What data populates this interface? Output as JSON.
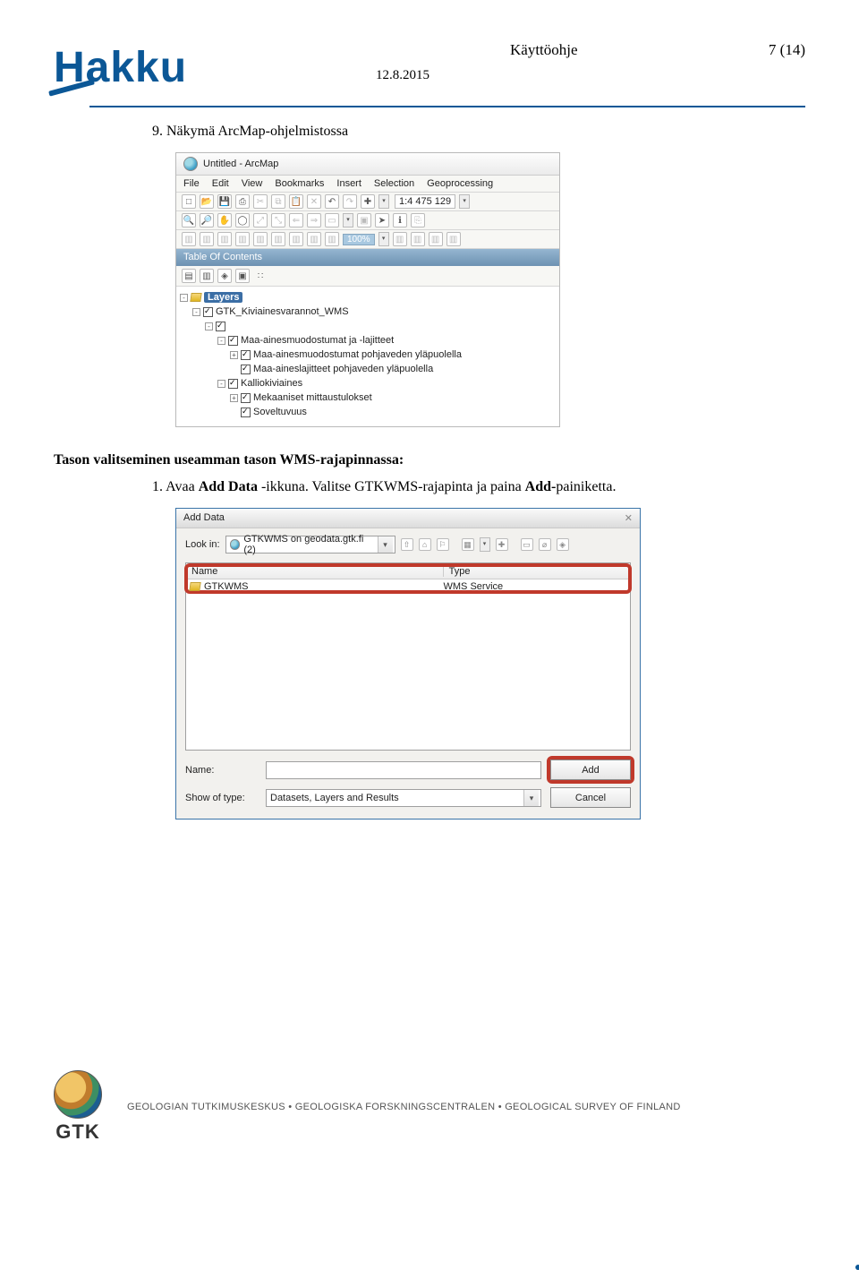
{
  "header": {
    "logo_text": "Hakku",
    "doc_title": "Käyttöohje",
    "page_of": "7 (14)",
    "date": "12.8.2015"
  },
  "step9": {
    "num": "9.",
    "text": "Näkymä ArcMap-ohjelmistossa"
  },
  "arcmap": {
    "title": "Untitled - ArcMap",
    "menu": [
      "File",
      "Edit",
      "View",
      "Bookmarks",
      "Insert",
      "Selection",
      "Geoprocessing"
    ],
    "scale": "1:4 475 129",
    "percent": "100%",
    "toc_title": "Table Of Contents",
    "layers_label": "Layers",
    "tree": [
      {
        "label": "GTK_Kiviainesvarannot_WMS",
        "indent": 1,
        "checked": true,
        "expander": "-"
      },
      {
        "label": "",
        "indent": 2,
        "checked": true,
        "expander": "-"
      },
      {
        "label": "Maa-ainesmuodostumat ja -lajitteet",
        "indent": 3,
        "checked": true,
        "expander": "-"
      },
      {
        "label": "Maa-ainesmuodostumat pohjaveden yläpuolella",
        "indent": 4,
        "checked": true,
        "expander": "+"
      },
      {
        "label": "Maa-aineslajitteet pohjaveden yläpuolella",
        "indent": 4,
        "checked": true,
        "expander": ""
      },
      {
        "label": "Kalliokiviaines",
        "indent": 3,
        "checked": true,
        "expander": "-"
      },
      {
        "label": "Mekaaniset mittaustulokset",
        "indent": 4,
        "checked": true,
        "expander": "+"
      },
      {
        "label": "Soveltuvuus",
        "indent": 4,
        "checked": true,
        "expander": ""
      }
    ]
  },
  "section_heading": "Tason valitseminen useamman tason WMS-rajapinnassa:",
  "step1": {
    "num": "1.",
    "text_a": "Avaa ",
    "bold_a": "Add Data",
    "text_b": " -ikkuna. Valitse GTKWMS-rajapinta ja paina ",
    "bold_b": "Add-",
    "text_c": "painiketta."
  },
  "adddata": {
    "title": "Add Data",
    "lookin_label": "Look in:",
    "lookin_value": "GTKWMS on geodata.gtk.fi (2)",
    "col_name": "Name",
    "col_type": "Type",
    "row_name": "GTKWMS",
    "row_type": "WMS Service",
    "name_label": "Name:",
    "name_value": "",
    "showof_label": "Show of type:",
    "showof_value": "Datasets, Layers and Results",
    "add_btn": "Add",
    "cancel_btn": "Cancel"
  },
  "footer": {
    "gtk": "GTK",
    "line": "GEOLOGIAN TUTKIMUSKESKUS  •  GEOLOGISKA FORSKNINGSCENTRALEN  •  GEOLOGICAL SURVEY OF FINLAND"
  }
}
